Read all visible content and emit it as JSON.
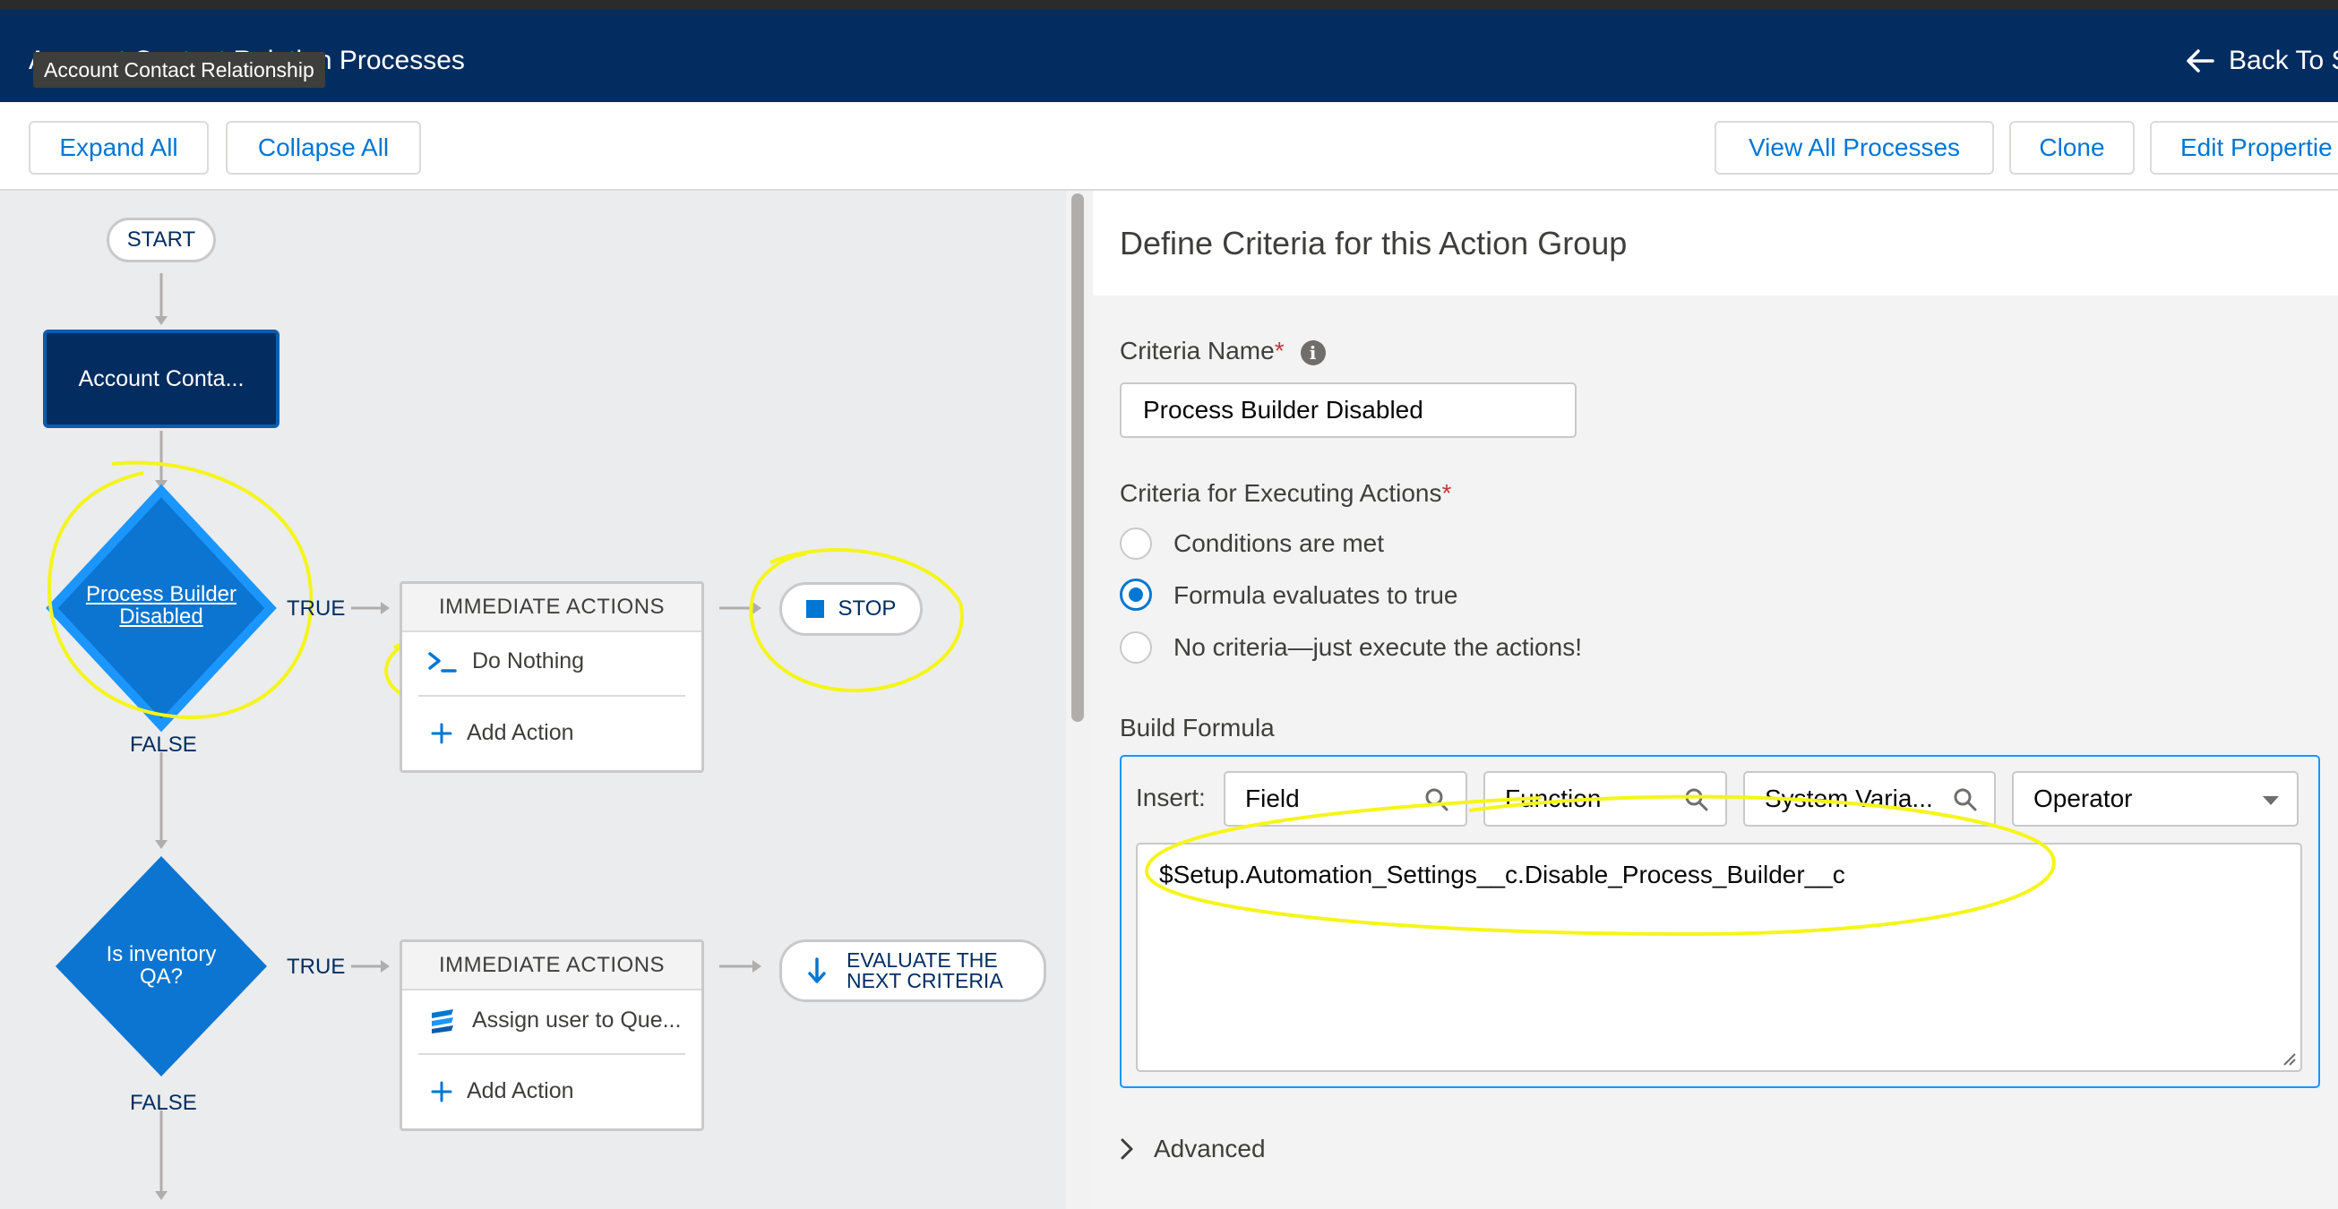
{
  "header": {
    "title": "Account Contact Relation Processes",
    "tooltip": "Account Contact Relationship",
    "back_label": "Back To S"
  },
  "toolbar": {
    "expand_all": "Expand All",
    "collapse_all": "Collapse All",
    "view_all_processes": "View All Processes",
    "clone": "Clone",
    "edit_properties": "Edit Propertie"
  },
  "canvas": {
    "start": "START",
    "object_node": "Account Conta...",
    "criteria_1": {
      "label_line1": "Process Builder",
      "label_line2": "Disabled",
      "true_label": "TRUE",
      "false_label": "FALSE",
      "actions_header": "IMMEDIATE ACTIONS",
      "action_item": "Do Nothing",
      "add_action": "Add Action",
      "end_label": "STOP"
    },
    "criteria_2": {
      "label_line1": "Is inventory",
      "label_line2": "QA?",
      "true_label": "TRUE",
      "false_label": "FALSE",
      "actions_header": "IMMEDIATE ACTIONS",
      "action_item": "Assign user to Que...",
      "add_action": "Add Action",
      "end_line1": "EVALUATE THE",
      "end_line2": "NEXT CRITERIA"
    }
  },
  "panel": {
    "title": "Define Criteria for this Action Group",
    "criteria_name_label": "Criteria Name",
    "criteria_name_value": "Process Builder Disabled",
    "required_mark": "*",
    "executing_label": "Criteria for Executing Actions",
    "options": [
      {
        "label": "Conditions are met",
        "selected": false
      },
      {
        "label": "Formula evaluates to true",
        "selected": true
      },
      {
        "label": "No criteria—just execute the actions!",
        "selected": false
      }
    ],
    "build_formula_label": "Build Formula",
    "insert_label": "Insert:",
    "field_placeholder": "Field",
    "function_placeholder": "Function",
    "system_variable": "System Varia...",
    "operator": "Operator",
    "formula": "$Setup.Automation_Settings__c.Disable_Process_Builder__c",
    "advanced": "Advanced"
  },
  "colors": {
    "header_bg": "#032d60",
    "brand_blue": "#0176d3",
    "diamond_blue": "#0b75d1",
    "annotation": "#f5f51a"
  },
  "icons": [
    "arrow-left-icon",
    "info-icon",
    "search-icon",
    "caret-down-icon",
    "chevron-right-icon",
    "terminal-icon",
    "plus-icon",
    "stop-icon",
    "arrow-down-icon",
    "queue-icon"
  ]
}
